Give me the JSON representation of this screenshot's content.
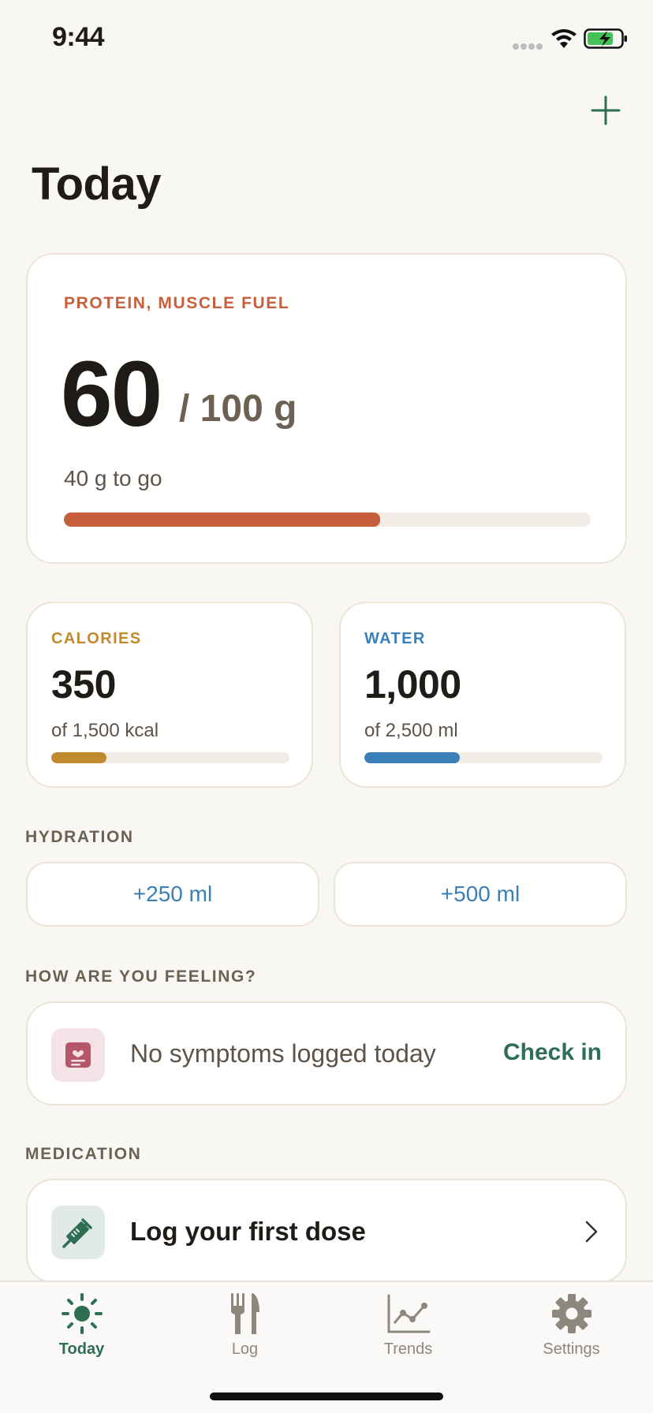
{
  "status_bar": {
    "time": "9:44"
  },
  "header": {
    "title": "Today",
    "add_icon": "plus-icon"
  },
  "protein": {
    "eyebrow": "PROTEIN, MUSCLE FUEL",
    "value": "60",
    "goal": "/ 100 g",
    "remaining": "40 g to go",
    "progress": 0.6,
    "color": "#C75F3D"
  },
  "calories": {
    "eyebrow": "CALORIES",
    "value": "350",
    "sub": "of 1,500 kcal",
    "progress": 0.233,
    "color": "#C08A2E"
  },
  "water": {
    "eyebrow": "WATER",
    "value": "1,000",
    "sub": "of 2,500 ml",
    "progress": 0.4,
    "color": "#3A7FB8"
  },
  "hydration": {
    "label": "HYDRATION",
    "buttons": [
      "+250 ml",
      "+500 ml"
    ]
  },
  "feeling": {
    "label": "HOW ARE YOU FEELING?",
    "text": "No symptoms logged today",
    "action": "Check in",
    "icon": "heart-journal-icon"
  },
  "medication": {
    "label": "MEDICATION",
    "text": "Log your first dose",
    "icon": "syringe-icon"
  },
  "tabs": [
    {
      "label": "Today",
      "icon": "sun-icon",
      "active": true
    },
    {
      "label": "Log",
      "icon": "fork-knife-icon",
      "active": false
    },
    {
      "label": "Trends",
      "icon": "trend-chart-icon",
      "active": false
    },
    {
      "label": "Settings",
      "icon": "gear-icon",
      "active": false
    }
  ]
}
